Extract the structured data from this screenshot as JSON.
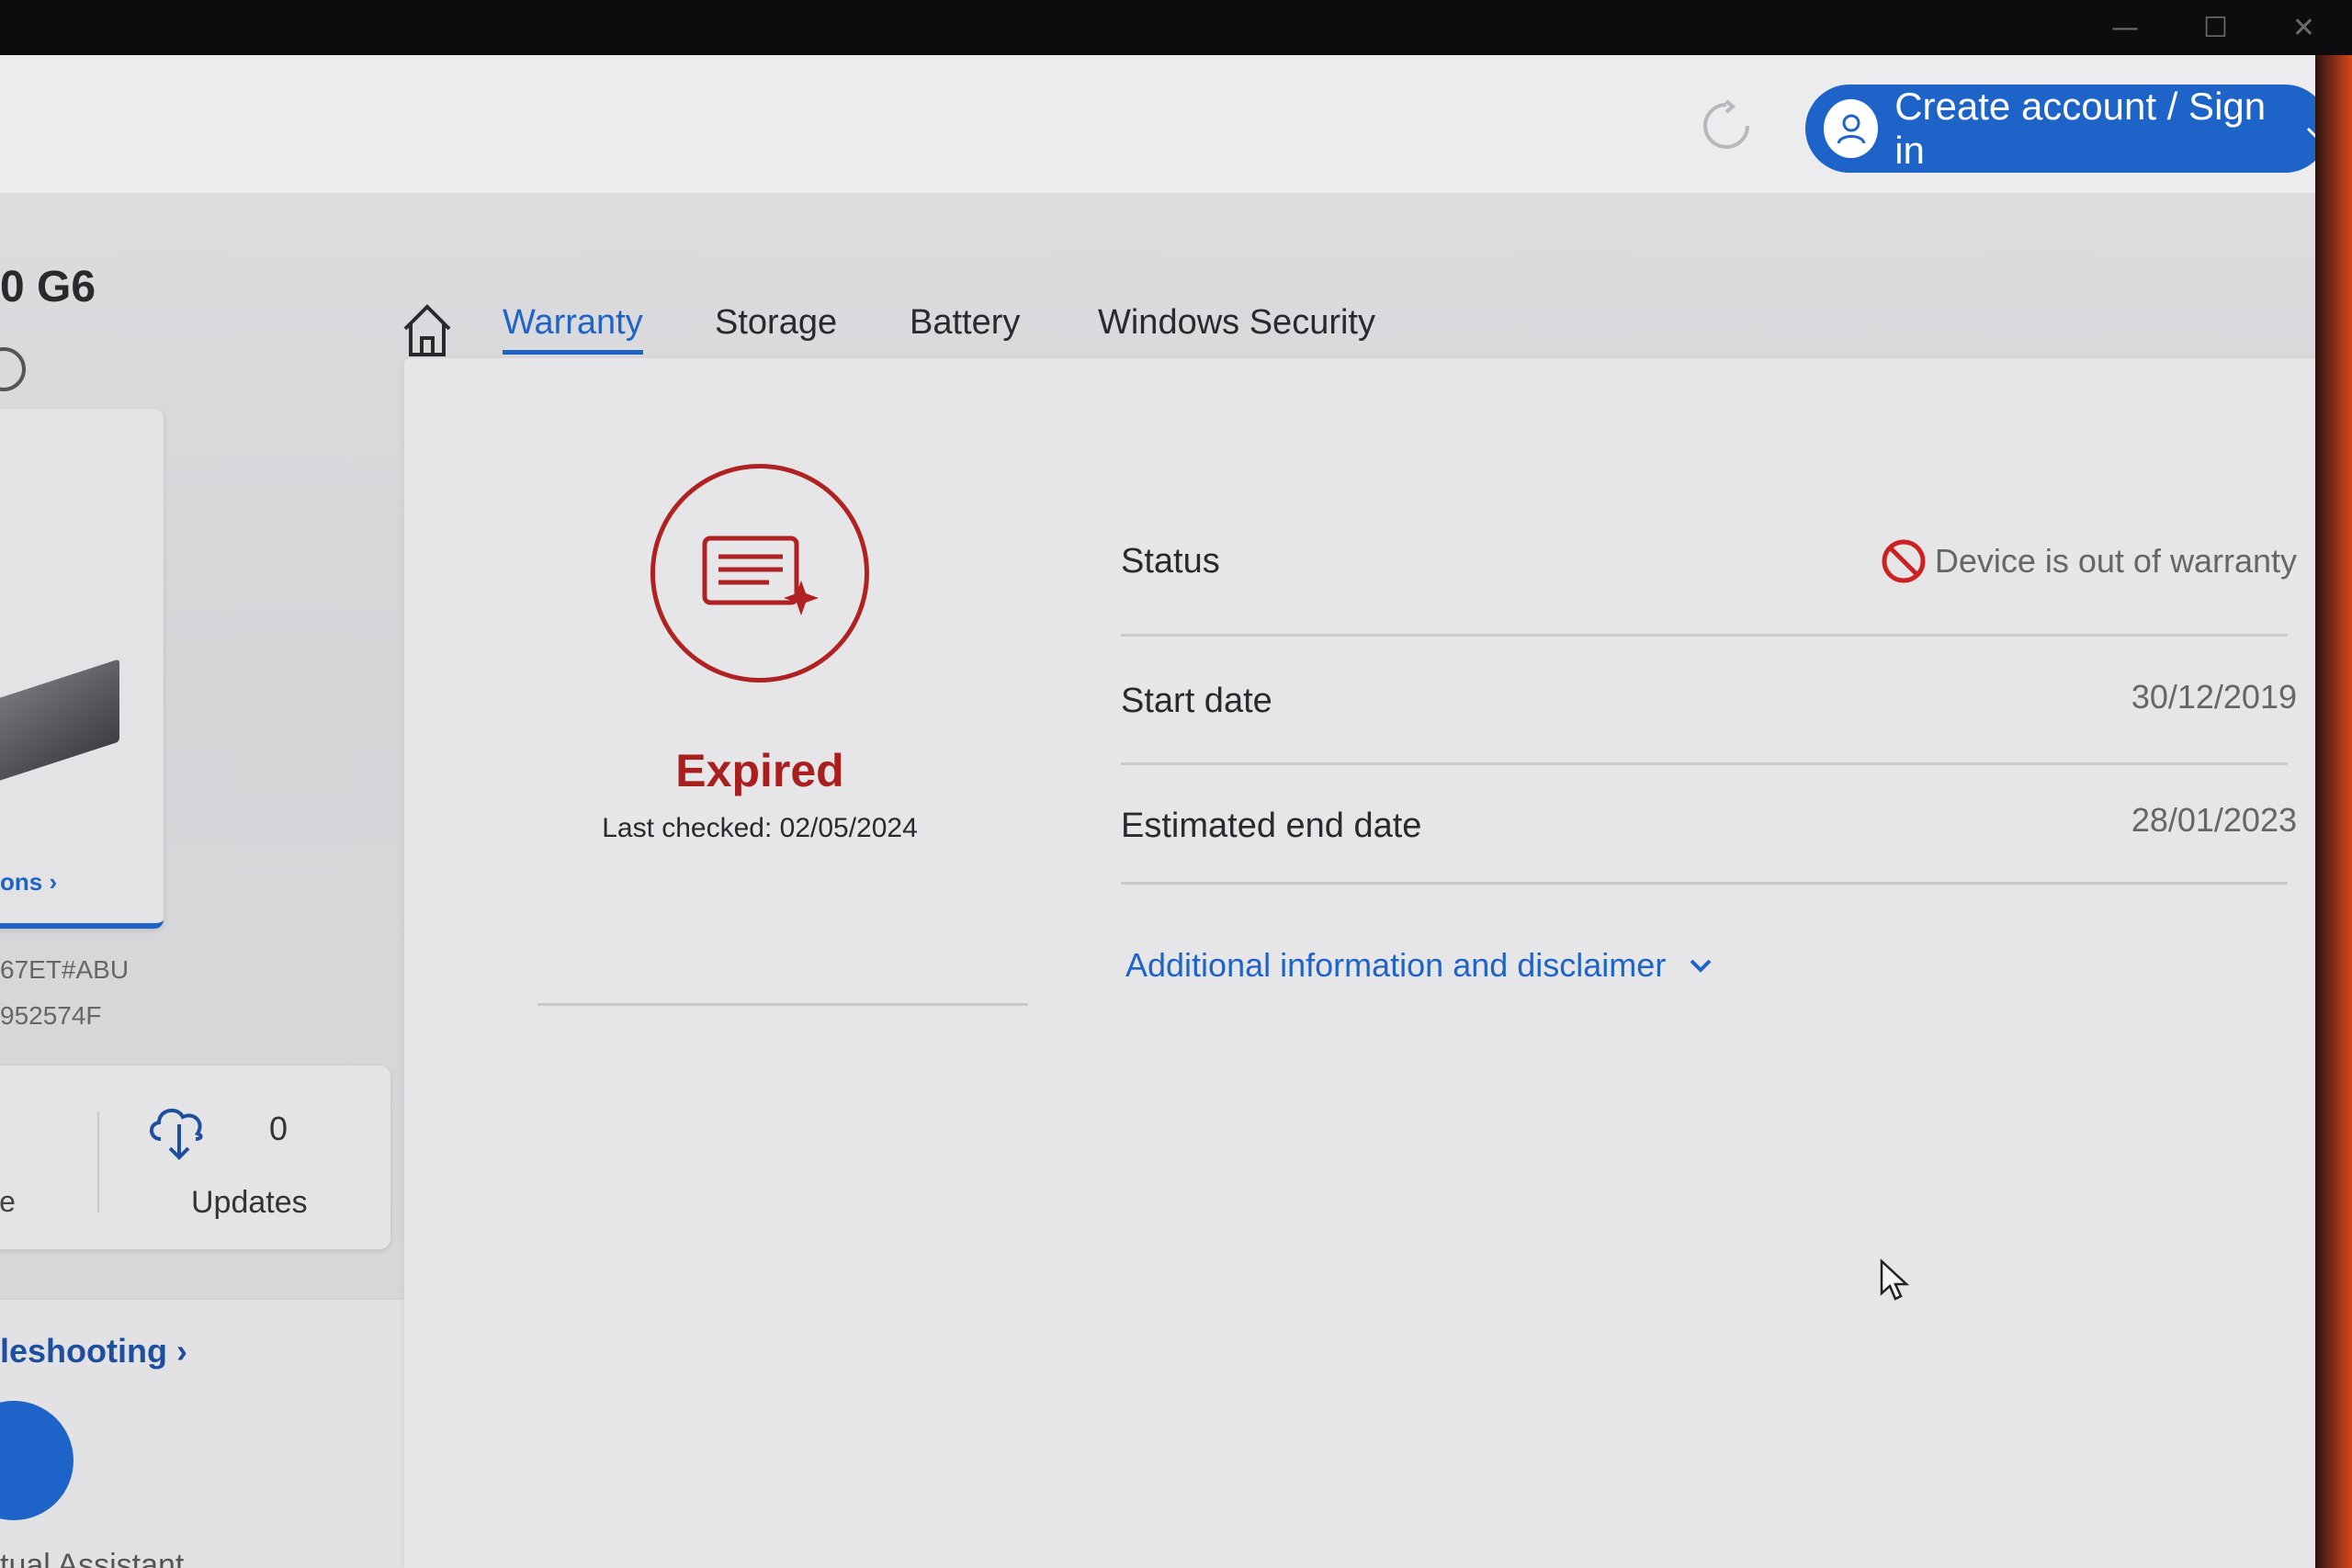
{
  "window": {
    "controls": {
      "minimize": "—",
      "maximize": "☐",
      "close": "✕"
    }
  },
  "header": {
    "signin_label": "Create account / Sign in"
  },
  "sidebar": {
    "model_fragment": "0 G6",
    "options_link": "ons ›",
    "product_number": "67ET#ABU",
    "serial_number": "952574F",
    "service_label": "vice",
    "updates_count": "0",
    "updates_label": "Updates",
    "troubleshooting_link": "leshooting ›",
    "virtual_assistant_label": "tual Assistant"
  },
  "tabs": [
    {
      "label": "Warranty",
      "active": true
    },
    {
      "label": "Storage",
      "active": false
    },
    {
      "label": "Battery",
      "active": false
    },
    {
      "label": "Windows Security",
      "active": false
    }
  ],
  "warranty": {
    "state": "Expired",
    "last_checked": "Last checked: 02/05/2024",
    "rows": [
      {
        "label": "Status",
        "value": "Device is out of warranty"
      },
      {
        "label": "Start date",
        "value": "30/12/2019"
      },
      {
        "label": "Estimated end date",
        "value": "28/01/2023"
      }
    ],
    "additional_info_link": "Additional information and disclaimer"
  },
  "colors": {
    "accent_blue": "#1e64c8",
    "expired_red": "#a91f1f"
  },
  "icons": [
    "refresh-icon",
    "user-icon",
    "chevron-down-icon",
    "home-icon",
    "cloud-download-icon",
    "warranty-certificate-icon",
    "no-entry-icon",
    "cursor-icon"
  ]
}
